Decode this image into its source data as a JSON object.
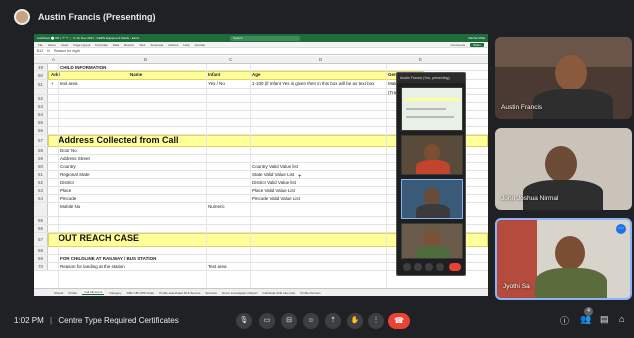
{
  "presenter": {
    "label": "Austin Francis (Presenting)"
  },
  "excel": {
    "titlebar": "AutoSave  ⬤ Off  ⌖  ↶  ↷  ⋮     ⊡  Jm Nov 2021 - GERS Equipment Fields - Excel",
    "search_placeholder": "Search",
    "account": "Rachel Pillai",
    "ribbon": [
      "File",
      "Home",
      "Insert",
      "Page Layout",
      "Formulas",
      "Data",
      "Review",
      "View",
      "Automate",
      "Add-ins",
      "Help",
      "Acrobat"
    ],
    "comments_label": "Comments",
    "share_label": "Share",
    "name_box": "B12",
    "formula": "Reason for night",
    "columns": [
      "A",
      "B",
      "C",
      "D",
      "E"
    ],
    "rows": [
      {
        "n": "49",
        "a": "",
        "b": "CHILD INFORMATION",
        "c": "",
        "d": "",
        "e": ""
      },
      {
        "n": "50",
        "a": "Add",
        "b": "Name",
        "c": "Infant",
        "d": "Age",
        "e": "Gender"
      },
      {
        "n": "51",
        "a": "+",
        "b": "text area",
        "c": "Yes / No",
        "d": "1-100 (if Infant Yes is given then in this box will be as text box",
        "e": "Male, Female, Other"
      },
      {
        "n": "",
        "a": "",
        "b": "",
        "c": "",
        "d": "",
        "e": "(Transgender etc)"
      },
      {
        "n": "52",
        "a": "",
        "b": "",
        "c": "",
        "d": "",
        "e": ""
      },
      {
        "n": "53",
        "a": "",
        "b": "",
        "c": "",
        "d": "",
        "e": ""
      },
      {
        "n": "54",
        "a": "",
        "b": "",
        "c": "",
        "d": "",
        "e": ""
      },
      {
        "n": "55",
        "a": "",
        "b": "",
        "c": "",
        "d": "",
        "e": ""
      },
      {
        "n": "56",
        "a": "",
        "b": "",
        "c": "",
        "d": "",
        "e": ""
      },
      {
        "n": "57",
        "a": "",
        "b": "Address Collected from Call",
        "c": "",
        "d": "",
        "e": ""
      },
      {
        "n": "58",
        "a": "",
        "b": "Door No",
        "c": "",
        "d": "",
        "e": ""
      },
      {
        "n": "59",
        "a": "",
        "b": "Address Street",
        "c": "",
        "d": "",
        "e": ""
      },
      {
        "n": "60",
        "a": "",
        "b": "Country",
        "c": "",
        "d": "Country Valid Value list",
        "e": ""
      },
      {
        "n": "61",
        "a": "",
        "b": "Regional State",
        "c": "",
        "d": "State Valid Value List",
        "e": ""
      },
      {
        "n": "62",
        "a": "",
        "b": "District",
        "c": "",
        "d": "District Valid Value list",
        "e": ""
      },
      {
        "n": "63",
        "a": "",
        "b": "Place",
        "c": "",
        "d": "Place Valid Value List",
        "e": ""
      },
      {
        "n": "64",
        "a": "",
        "b": "Pincode",
        "c": "",
        "d": "Pincode Valid Value List",
        "e": ""
      },
      {
        "n": "",
        "a": "",
        "b": "Mobile No",
        "c": "Numeric",
        "d": "",
        "e": ""
      },
      {
        "n": "65",
        "a": "",
        "b": "",
        "c": "",
        "d": "",
        "e": ""
      },
      {
        "n": "66",
        "a": "",
        "b": "",
        "c": "",
        "d": "",
        "e": ""
      },
      {
        "n": "67",
        "a": "",
        "b": "OUT REACH CASE",
        "c": "",
        "d": "",
        "e": ""
      },
      {
        "n": "68",
        "a": "",
        "b": "",
        "c": "",
        "d": "",
        "e": ""
      },
      {
        "n": "69",
        "a": "",
        "b": "FOR CHILDLINE AT RAILWAY / BUS STATION",
        "c": "",
        "d": "",
        "e": ""
      },
      {
        "n": "70",
        "a": "",
        "b": "Reason for landing at the station",
        "c": "Text area",
        "d": "",
        "e": ""
      }
    ],
    "cursor_char": "+",
    "sheet_tabs": [
      "Sheet1",
      "Profile",
      "Call Allotment",
      "Category",
      "DMC UB OPD Order",
      "Profile associated ID & Service",
      "Services",
      "Home Investigation Report",
      "Individual child care plan",
      "Profile Persons"
    ],
    "active_tab": "Call Allotment"
  },
  "meet_panel": {
    "title": "Austin Francis (You, presenting)"
  },
  "participants": [
    {
      "name": "Austin Francis"
    },
    {
      "name": "John Joshua Nirmal"
    },
    {
      "name": "Jyothi Sa"
    }
  ],
  "footer": {
    "time": "1:02 PM",
    "separator": "|",
    "meeting_title": "Centre Type Required Certificates",
    "participant_count": "4"
  },
  "icons": [
    "mic-icon",
    "camera-icon",
    "captions-icon",
    "emoji-icon",
    "present-icon",
    "raise-hand-icon",
    "more-icon",
    "end-call-icon",
    "info-icon",
    "people-icon",
    "chat-icon",
    "activities-icon"
  ],
  "colors": {
    "excel_green": "#1e6b3c",
    "band_yellow": "#ffff99",
    "end_call": "#ea4335",
    "meet_bg": "#202124"
  }
}
